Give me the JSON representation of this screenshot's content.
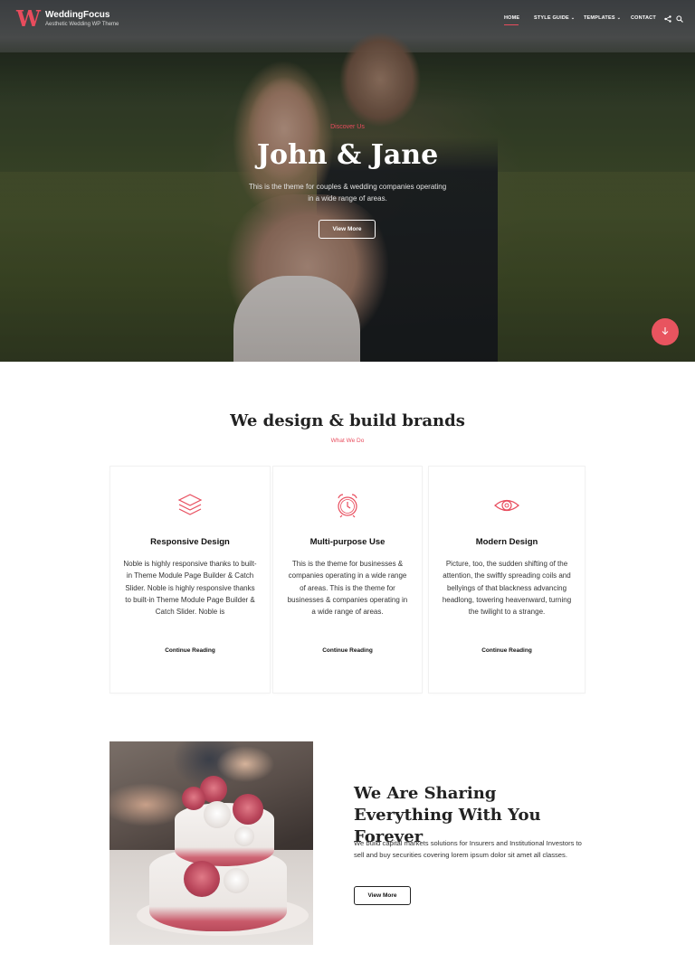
{
  "header": {
    "logo_letter": "W",
    "site_title": "WeddingFocus",
    "site_tagline": "Aesthetic Wedding WP Theme",
    "nav": [
      {
        "label": "HOME",
        "active": true
      },
      {
        "label": "STYLE GUIDE",
        "has_dropdown": true
      },
      {
        "label": "TEMPLATES",
        "has_dropdown": true
      },
      {
        "label": "CONTACT"
      }
    ],
    "icons": [
      "share-icon",
      "search-icon"
    ]
  },
  "hero": {
    "kicker": "Discover Us",
    "title": "John & Jane",
    "description": "This is the theme for couples & wedding companies operating in a wide range of areas.",
    "button_label": "View More",
    "scroll_icon": "arrow-down-icon"
  },
  "services": {
    "title": "We design & build brands",
    "subtitle": "What We Do",
    "cards": [
      {
        "icon": "layers-icon",
        "title": "Responsive Design",
        "text": "Noble is highly responsive thanks to built-in Theme Module Page Builder & Catch Slider. Noble is highly responsive thanks to built-in Theme Module Page Builder & Catch Slider. Noble is",
        "link": "Continue Reading"
      },
      {
        "icon": "alarm-clock-icon",
        "title": "Multi-purpose Use",
        "text": "This is the theme for businesses & companies operating in a wide range of areas. This is the theme for businesses & companies operating in a wide range of areas.",
        "link": "Continue Reading"
      },
      {
        "icon": "eye-icon",
        "title": "Modern Design",
        "text": "Picture, too, the sudden shifting of the attention, the swiftly spreading coils and bellyings of that blackness advancing headlong, towering heavenward, turning the twilight to a strange.",
        "link": "Continue Reading"
      }
    ]
  },
  "about": {
    "title": "We Are Sharing Everything With You Forever",
    "text": "We build capital markets solutions for Insurers and Institutional Investors to sell and buy securities covering lorem ipsum dolor sit amet all classes.",
    "button_label": "View More"
  },
  "colors": {
    "accent": "#e84c5d",
    "text": "#222222",
    "background": "#ffffff"
  }
}
